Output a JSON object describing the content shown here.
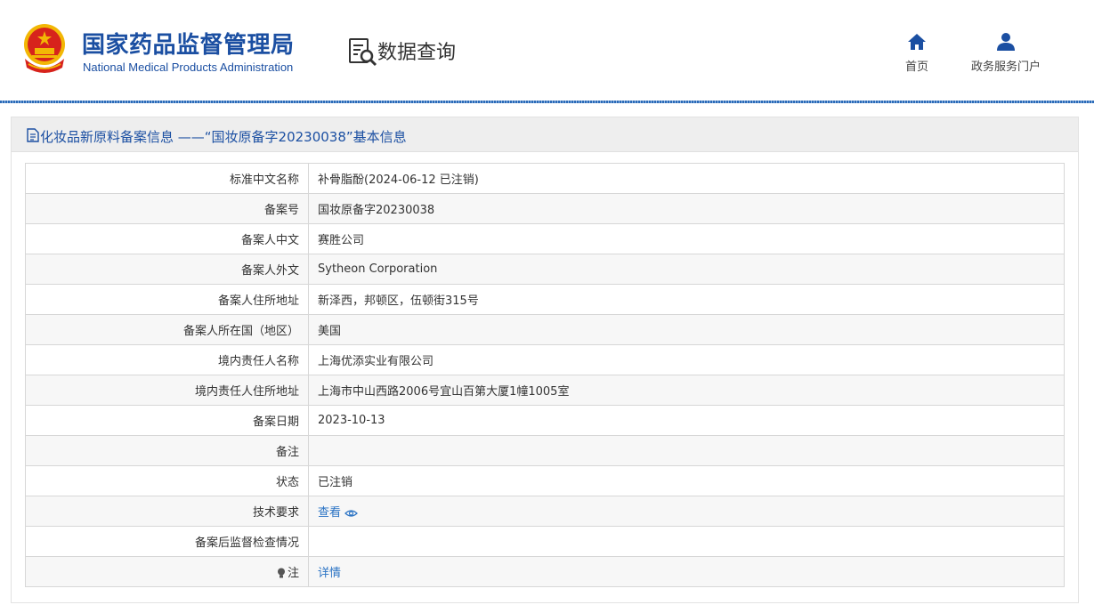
{
  "header": {
    "org_name_cn": "国家药品监督管理局",
    "org_name_en": "National Medical Products Administration",
    "query_title": "数据查询",
    "nav": [
      {
        "label": "首页",
        "icon": "home-icon"
      },
      {
        "label": "政务服务门户",
        "icon": "user-icon"
      }
    ]
  },
  "panel": {
    "title": "化妆品新原料备案信息 ——“国妆原备字20230038”基本信息",
    "rows": [
      {
        "label": "标准中文名称",
        "value": "补骨脂酚(2024-06-12 已注销)"
      },
      {
        "label": "备案号",
        "value": "国妆原备字20230038"
      },
      {
        "label": "备案人中文",
        "value": "赛胜公司"
      },
      {
        "label": "备案人外文",
        "value": "Sytheon Corporation"
      },
      {
        "label": "备案人住所地址",
        "value": "新泽西，邦顿区，伍顿街315号"
      },
      {
        "label": "备案人所在国（地区）",
        "value": "美国"
      },
      {
        "label": "境内责任人名称",
        "value": "上海优添实业有限公司"
      },
      {
        "label": "境内责任人住所地址",
        "value": "上海市中山西路2006号宜山百第大厦1幢1005室"
      },
      {
        "label": "备案日期",
        "value": "2023-10-13"
      },
      {
        "label": "备注",
        "value": ""
      },
      {
        "label": "状态",
        "value": "已注销"
      },
      {
        "label": "技术要求",
        "value": "查看"
      },
      {
        "label": "备案后监督检查情况",
        "value": ""
      },
      {
        "label": "注",
        "value": "详情"
      }
    ]
  },
  "colors": {
    "brand_blue": "#1b4fa2",
    "link_blue": "#2a73c4",
    "emblem_red": "#d7231c",
    "emblem_gold": "#f2b705"
  }
}
